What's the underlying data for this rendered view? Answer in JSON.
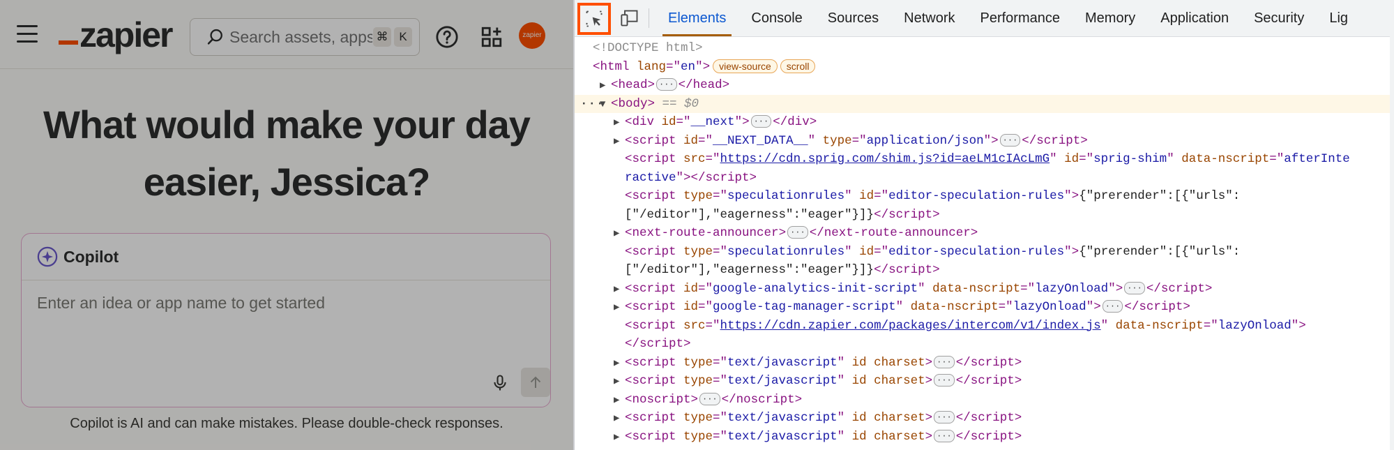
{
  "app": {
    "logo_text": "zapier",
    "search_placeholder": "Search assets, apps",
    "search_shortcut": [
      "⌘",
      "K"
    ],
    "avatar_label": "zapier",
    "heading_line1": "What would make your day",
    "heading_line2": "easier, Jessica?",
    "copilot_title": "Copilot",
    "copilot_placeholder": "Enter an idea or app name to get started",
    "disclaimer": "Copilot is AI and can make mistakes. Please double-check responses.",
    "brand_color": "#ff4f00"
  },
  "devtools": {
    "tabs": [
      "Elements",
      "Console",
      "Sources",
      "Network",
      "Performance",
      "Memory",
      "Application",
      "Security",
      "Lig"
    ],
    "active_tab": "Elements",
    "doctype": "<!DOCTYPE html>",
    "html_lang": "en",
    "html_badges": [
      "view-source",
      "scroll"
    ],
    "body_marker": "== $0",
    "lines": {
      "next_id": "__next",
      "next_data_id": "__NEXT_DATA__",
      "next_data_type": "application/json",
      "sprig_src": "https://cdn.sprig.com/shim.js?id=aeLM1cIAcLmG",
      "sprig_id": "sprig-shim",
      "sprig_nscript": "afterInte",
      "sprig_nscript_wrap": "ractive",
      "spec_type": "speculationrules",
      "spec_id": "editor-speculation-rules",
      "spec_text1": "{\"prerender\":[{\"urls\":",
      "spec_text2": "[\"/editor\"],\"eagerness\":\"eager\"}]}",
      "announcer": "next-route-announcer",
      "ga_id": "google-analytics-init-script",
      "gtm_id": "google-tag-manager-script",
      "lazy": "lazyOnload",
      "intercom_src": "https://cdn.zapier.com/packages/intercom/v1/index.js",
      "js_type": "text/javascript"
    }
  }
}
